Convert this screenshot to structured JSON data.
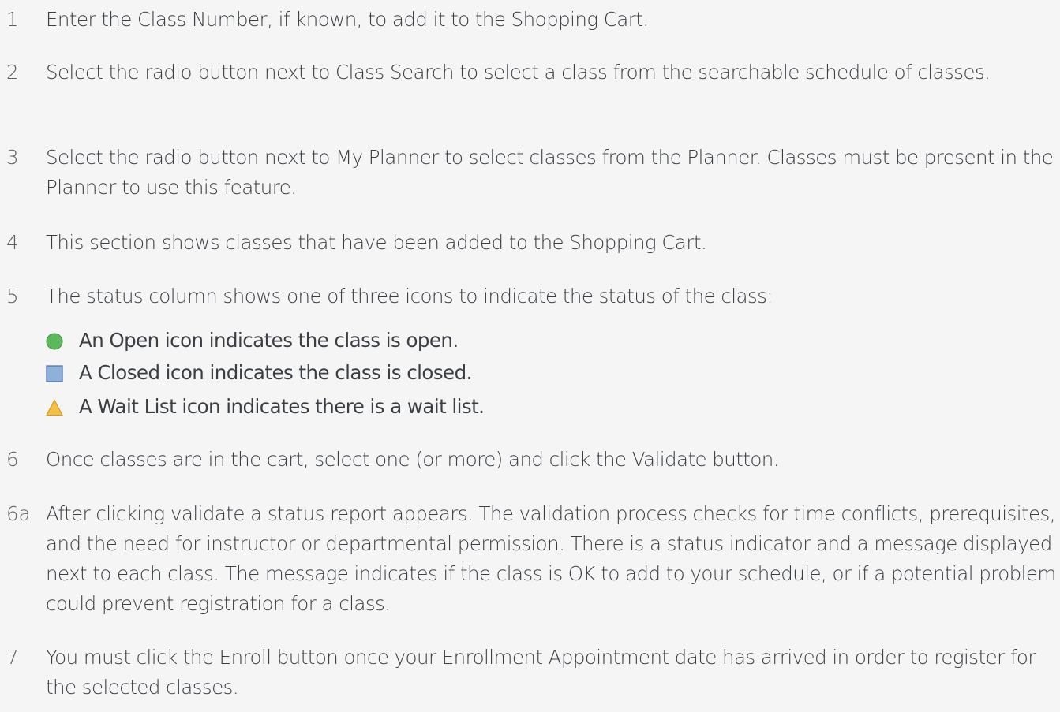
{
  "steps": [
    {
      "num": "1",
      "text": "Enter the Class Number, if known, to add it to the Shopping Cart."
    },
    {
      "num": "2",
      "text": "Select the radio button next to Class Search to select a class from the searchable schedule of classes."
    },
    {
      "num": "3",
      "text": "Select the radio button next to My Planner to select classes from the Planner. Classes must be present in the Planner to use this feature."
    },
    {
      "num": "4",
      "text": "This section shows classes that have been added to the Shopping Cart."
    },
    {
      "num": "5",
      "text": "The status column shows one of three icons to indicate the status of the class:"
    },
    {
      "num": "6",
      "text": "Once classes are in the cart, select one (or more) and click the Validate button."
    },
    {
      "num": "6a",
      "text": "After clicking validate a status report appears. The validation process checks for time conflicts, prerequisites, and the need for instructor or departmental permission. There is a status indicator and a message displayed next to each class. The message indicates if the class is OK to add to your schedule, or if a potential problem could prevent registration for a class."
    },
    {
      "num": "7",
      "text": "You must click the Enroll button once your Enrollment Appointment date has arrived in order to register for the selected classes."
    }
  ],
  "status_icons": [
    {
      "icon": "open-circle-icon",
      "color": "#5cb85c",
      "label": "An Open icon indicates the class is open."
    },
    {
      "icon": "closed-square-icon",
      "color": "#8fb0d9",
      "label": "A Closed icon indicates the class is closed."
    },
    {
      "icon": "wait-list-triangle-icon",
      "color": "#f5c04a",
      "label": "A Wait List icon indicates there is a wait list."
    }
  ]
}
